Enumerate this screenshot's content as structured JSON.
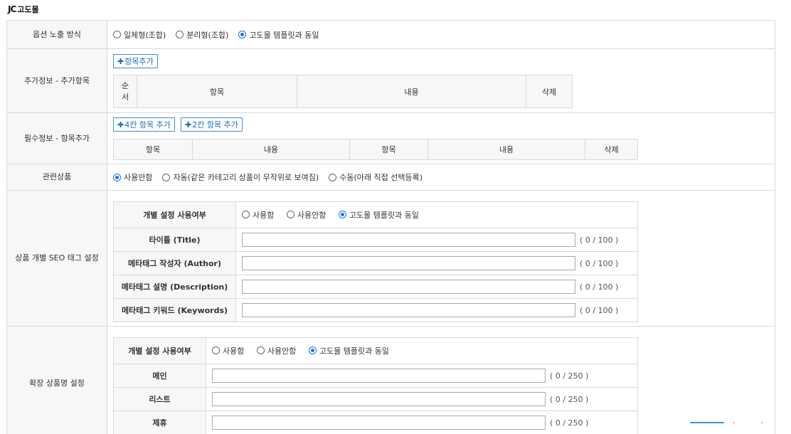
{
  "logo": {
    "mark": "JC",
    "text": "고도몰"
  },
  "option_display": {
    "label": "옵션 노출 방식",
    "options": [
      "일체형(조합)",
      "분리형(조합)",
      "고도몰 템플릿과 동일"
    ],
    "selected": 2
  },
  "extra_info": {
    "label": "추가정보 - 추가항목",
    "add_button": "항목추가",
    "columns": [
      "순서",
      "항목",
      "내용",
      "삭제"
    ]
  },
  "required_info": {
    "label": "필수정보 - 항목추가",
    "add4_button": "4칸 항목 추가",
    "add2_button": "2칸 항목 추가",
    "columns": [
      "항목",
      "내용",
      "항목",
      "내용",
      "삭제"
    ]
  },
  "related": {
    "label": "관련상품",
    "options": [
      "사용안함",
      "자동(같은 카테고리 상품이 무작위로 보여짐)",
      "수동(아래 직접 선택등록)"
    ],
    "selected": 0
  },
  "seo": {
    "label": "상품 개별 SEO 태그 설정",
    "use_label": "개별 설정 사용여부",
    "use_options": [
      "사용함",
      "사용안함",
      "고도몰 템플릿과 동일"
    ],
    "use_selected": 2,
    "fields": [
      {
        "label": "타이틀 (Title)",
        "count": "( 0 / 100 )"
      },
      {
        "label": "메타태그 작성자 (Author)",
        "count": "( 0 / 100 )"
      },
      {
        "label": "메타태그 설명 (Description)",
        "count": "( 0 / 100 )"
      },
      {
        "label": "메타태그 키워드 (Keywords)",
        "count": "( 0 / 100 )"
      }
    ]
  },
  "ext_name": {
    "label": "확장 상품명 설정",
    "use_label": "개별 설정 사용여부",
    "use_options": [
      "사용함",
      "사용안함",
      "고도몰 템플릿과 동일"
    ],
    "use_selected": 2,
    "fields": [
      {
        "label": "메인",
        "count": "( 0 / 250 )"
      },
      {
        "label": "리스트",
        "count": "( 0 / 250 )"
      },
      {
        "label": "제휴",
        "count": "( 0 / 250 )"
      }
    ]
  }
}
